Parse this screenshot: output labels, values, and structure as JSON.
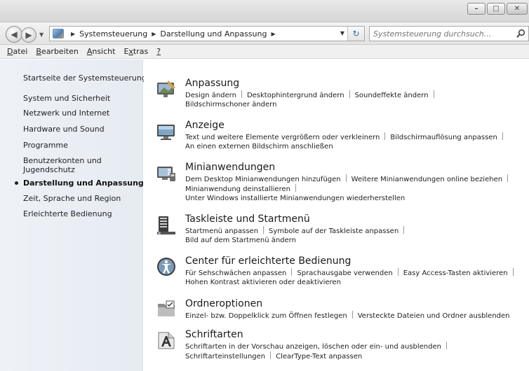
{
  "window": {
    "minimize_label": "–",
    "maximize_label": "□",
    "close_label": "✕"
  },
  "address": {
    "crumbs": [
      "Systemsteuerung",
      "Darstellung und Anpassung"
    ],
    "search_placeholder": "Systemsteuerung durchsuch..."
  },
  "menubar": {
    "items": [
      {
        "u": "D",
        "rest": "atei"
      },
      {
        "u": "B",
        "rest": "earbeiten"
      },
      {
        "u": "A",
        "rest": "nsicht"
      },
      {
        "pre": "E",
        "u": "x",
        "rest": "tras"
      },
      {
        "u": "?",
        "rest": ""
      }
    ]
  },
  "sidebar": {
    "items": [
      {
        "label": "Startseite der Systemsteuerung"
      },
      {
        "label": "System und Sicherheit"
      },
      {
        "label": "Netzwerk und Internet"
      },
      {
        "label": "Hardware und Sound"
      },
      {
        "label": "Programme"
      },
      {
        "label": "Benutzerkonten und"
      },
      {
        "label": "Jugendschutz"
      },
      {
        "label": "Darstellung und Anpassung"
      },
      {
        "label": "Zeit, Sprache und Region"
      },
      {
        "label": "Erleichterte Bedienung"
      }
    ]
  },
  "categories": [
    {
      "title": "Anpassung",
      "line1": [
        "Design ändern",
        "Desktophintergrund ändern",
        "Soundeffekte ändern"
      ],
      "line2": [
        "Bildschirmschoner ändern"
      ]
    },
    {
      "title": "Anzeige",
      "line1": [
        "Text und weitere Elemente vergrößern oder verkleinern",
        "Bildschirmauflösung anpassen"
      ],
      "line2": [
        "An einen externen Bildschirm anschließen"
      ]
    },
    {
      "title": "Minianwendungen",
      "line1": [
        "Dem Desktop Minianwendungen hinzufügen",
        "Weitere Minianwendungen online beziehen"
      ],
      "line2": [
        "Minianwendung deinstallieren"
      ],
      "line3": [
        "Unter Windows installierte Minianwendungen wiederherstellen"
      ]
    },
    {
      "title": "Taskleiste und Startmenü",
      "line1": [
        "Startmenü anpassen",
        "Symbole auf der Taskleiste anpassen"
      ],
      "line2": [
        "Bild auf dem Startmenü ändern"
      ]
    },
    {
      "title": "Center für erleichterte Bedienung",
      "line1": [
        "Für Sehschwächen anpassen",
        "Sprachausgabe verwenden",
        "Easy Access-Tasten aktivieren"
      ],
      "line2": [
        "Hohen Kontrast aktivieren oder deaktivieren"
      ]
    },
    {
      "title": "Ordneroptionen",
      "line1": [
        "Einzel- bzw. Doppelklick zum Öffnen festlegen",
        "Versteckte Dateien und Ordner ausblenden"
      ]
    },
    {
      "title": "Schriftarten",
      "line1": [
        "Schriftarten in der Vorschau anzeigen, löschen oder ein- und ausblenden"
      ],
      "line2": [
        "Schriftarteinstellungen",
        "ClearType-Text anpassen"
      ]
    }
  ]
}
